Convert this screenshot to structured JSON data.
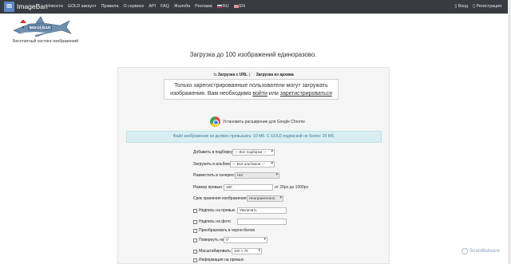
{
  "nav": {
    "logo_text": "IB",
    "brand": "ImageBan",
    "links": [
      "Новости",
      "GOLD аккаунт",
      "Правила",
      "О сервисе",
      "API",
      "FAQ",
      "Жалоба",
      "Реклама"
    ],
    "lang_ru": "RU",
    "lang_en": "EN",
    "login": "Вход",
    "register": "Регистрация"
  },
  "header": {
    "logo_text": "IMAGEBAN",
    "tagline": "Бесплатный хостинг изображений"
  },
  "main": {
    "heading": "Загрузка до 100 изображений единоразово.",
    "upload_url": "Загрузка с URL",
    "upload_archive": "Загрузка из архива",
    "notice_line1": "Только зарегистрированные пользователи могут загружать",
    "notice_line2_pre": "изображения. Вам необходимо ",
    "notice_login": "войти",
    "notice_or": " или ",
    "notice_register": "зарегистрироваться",
    "chrome_ext": "Установить расширение для Google Chrome",
    "info": "Файл изображения не должен превышать: 10 Мб. С GOLD подпиской не более: 20 Мб."
  },
  "form": {
    "add_to_set_label": "Добавить в подборку:",
    "add_to_set_value": "--- Все подборки ---",
    "upload_to_album_label": "Загрузить в альбом:",
    "upload_to_album_value": "--- Все альбомов ---",
    "gallery_label": "Разместить в галерее:",
    "gallery_value": "Нет",
    "preview_size_label": "Размер превью:",
    "preview_size_value": "180",
    "preview_size_hint": "от 20px до 1000px",
    "storage_label": "Срок хранения изображения:",
    "storage_value": "Неограниченно",
    "preview_caption_label": "Надпись на превью",
    "preview_caption_value": "Увеличить",
    "photo_caption_label": "Надпись на фото",
    "bw_label": "Преобразовать в черно-белое",
    "rotate_label": "Повернуть на",
    "rotate_value": "0°",
    "scale_label": "Масштабировать",
    "scale_value": "100 × 75",
    "info_preview_label": "Информация на превью"
  },
  "watermark": "ScanMalware"
}
